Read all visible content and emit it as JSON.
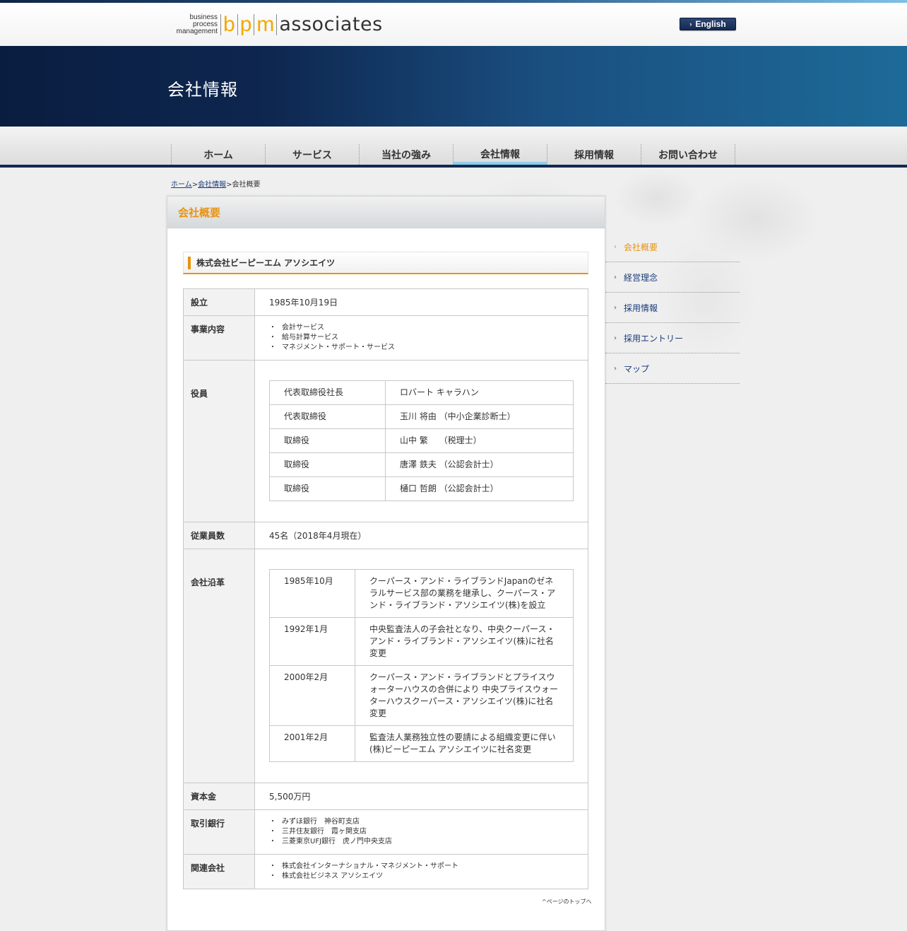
{
  "header": {
    "logo_small_line1": "business process",
    "logo_small_line2": "management",
    "logo_b": "b",
    "logo_p": "p",
    "logo_m": "m",
    "logo_assoc": "associates",
    "english_label": "English"
  },
  "banner": {
    "title": "会社情報"
  },
  "nav": {
    "items": [
      {
        "label": "ホーム"
      },
      {
        "label": "サービス"
      },
      {
        "label": "当社の強み"
      },
      {
        "label": "会社情報"
      },
      {
        "label": "採用情報"
      },
      {
        "label": "お問い合わせ"
      }
    ]
  },
  "breadcrumb": {
    "home": "ホーム",
    "company": "会社情報",
    "current": "会社概要"
  },
  "main": {
    "title": "会社概要",
    "company_name": "株式会社ビーピーエム アソシエイツ",
    "rows": {
      "founded": {
        "label": "設立",
        "value": "1985年10月19日"
      },
      "business": {
        "label": "事業内容",
        "items": [
          "会計サービス",
          "給与計算サービス",
          "マネジメント・サポート・サービス"
        ]
      },
      "officers": {
        "label": "役員",
        "items": [
          {
            "title": "代表取締役社長",
            "name": "ロバート キャラハン"
          },
          {
            "title": "代表取締役",
            "name": "玉川 将由 （中小企業診断士）"
          },
          {
            "title": "取締役",
            "name": "山中 繁　 （税理士）"
          },
          {
            "title": "取締役",
            "name": "唐澤 鉄夫 （公認会計士）"
          },
          {
            "title": "取締役",
            "name": "樋口 哲朗 （公認会計士）"
          }
        ]
      },
      "employees": {
        "label": "従業員数",
        "value": "45名（2018年4月現在）"
      },
      "history": {
        "label": "会社沿革",
        "items": [
          {
            "date": "1985年10月",
            "text": "クーパース・アンド・ライブランドJapanのゼネラルサービス部の業務を継承し、クーパース・アンド・ライブランド・アソシエイツ(株)を設立"
          },
          {
            "date": "1992年1月",
            "text": "中央監査法人の子会社となり、中央クーパース・アンド・ライブランド・アソシエイツ(株)に社名変更"
          },
          {
            "date": "2000年2月",
            "text": "クーパース・アンド・ライブランドとプライスウォーターハウスの合併により 中央プライスウォーターハウスクーパース・アソシエイツ(株)に社名変更"
          },
          {
            "date": "2001年2月",
            "text": "監査法人業務独立性の要請による組織変更に伴い(株)ビーピーエム アソシエイツに社名変更"
          }
        ]
      },
      "capital": {
        "label": "資本金",
        "value": "5,500万円"
      },
      "banks": {
        "label": "取引銀行",
        "items": [
          "みずほ銀行　神谷町支店",
          "三井住友銀行　霞ヶ関支店",
          "三菱東京UFJ銀行　虎ノ門中央支店"
        ]
      },
      "affiliates": {
        "label": "関連会社",
        "items": [
          "株式会社インターナショナル・マネジメント・サポート",
          "株式会社ビジネス アソシエイツ"
        ]
      }
    },
    "page_top": "ページのトップへ"
  },
  "sidenav": {
    "items": [
      {
        "label": "会社概要"
      },
      {
        "label": "経営理念"
      },
      {
        "label": "採用情報"
      },
      {
        "label": "採用エントリー"
      },
      {
        "label": "マップ"
      }
    ]
  },
  "colors": {
    "accent": "#e8930e",
    "navy": "#0e2750",
    "link": "#1a3b7a"
  }
}
